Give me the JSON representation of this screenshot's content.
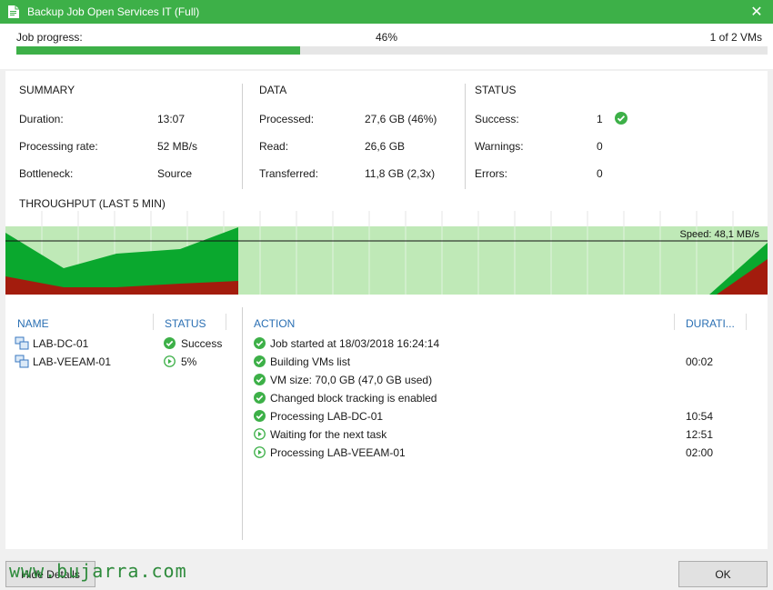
{
  "window": {
    "title": "Backup Job Open Services IT (Full)",
    "close_glyph": "✕"
  },
  "progress": {
    "label": "Job progress:",
    "percent_text": "46%",
    "percent": 46,
    "vms_text": "1 of 2 VMs"
  },
  "summary": {
    "title": "SUMMARY",
    "rows": [
      {
        "label": "Duration:",
        "value": "13:07"
      },
      {
        "label": "Processing rate:",
        "value": "52 MB/s"
      },
      {
        "label": "Bottleneck:",
        "value": "Source"
      }
    ]
  },
  "data_section": {
    "title": "DATA",
    "rows": [
      {
        "label": "Processed:",
        "value": "27,6 GB (46%)"
      },
      {
        "label": "Read:",
        "value": "26,6 GB"
      },
      {
        "label": "Transferred:",
        "value": "11,8 GB (2,3x)"
      }
    ]
  },
  "status_section": {
    "title": "STATUS",
    "rows": [
      {
        "label": "Success:",
        "value": "1"
      },
      {
        "label": "Warnings:",
        "value": "0"
      },
      {
        "label": "Errors:",
        "value": "0"
      }
    ]
  },
  "throughput": {
    "title": "THROUGHPUT (LAST 5 MIN)",
    "speed_label": "Speed: 48,1 MB/s"
  },
  "vms_table": {
    "headers": {
      "name": "NAME",
      "status": "STATUS"
    },
    "rows": [
      {
        "name": "LAB-DC-01",
        "status": "Success",
        "status_icon": "success-check-icon"
      },
      {
        "name": "LAB-VEEAM-01",
        "status": "5%",
        "status_icon": "running-play-icon"
      }
    ]
  },
  "actions_table": {
    "headers": {
      "action": "ACTION",
      "duration": "DURATI..."
    },
    "rows": [
      {
        "icon": "success-check-icon",
        "text": "Job started at 18/03/2018 16:24:14",
        "duration": ""
      },
      {
        "icon": "success-check-icon",
        "text": "Building VMs list",
        "duration": "00:02"
      },
      {
        "icon": "success-check-icon",
        "text": "VM size: 70,0 GB (47,0 GB used)",
        "duration": ""
      },
      {
        "icon": "success-check-icon",
        "text": "Changed block tracking is enabled",
        "duration": ""
      },
      {
        "icon": "success-check-icon",
        "text": "Processing LAB-DC-01",
        "duration": "10:54"
      },
      {
        "icon": "running-play-icon",
        "text": "Waiting for the next task",
        "duration": "12:51"
      },
      {
        "icon": "running-play-icon",
        "text": "Processing LAB-VEEAM-01",
        "duration": "02:00"
      }
    ]
  },
  "buttons": {
    "hide_details": "Hide Details",
    "ok": "OK"
  },
  "watermark": "www.bujarra.com",
  "colors": {
    "accent": "#3db048",
    "link": "#2a6fb3",
    "read": "#0aa82e",
    "transfer": "#a31c0d",
    "bg_fill": "#bfe9b7"
  }
}
